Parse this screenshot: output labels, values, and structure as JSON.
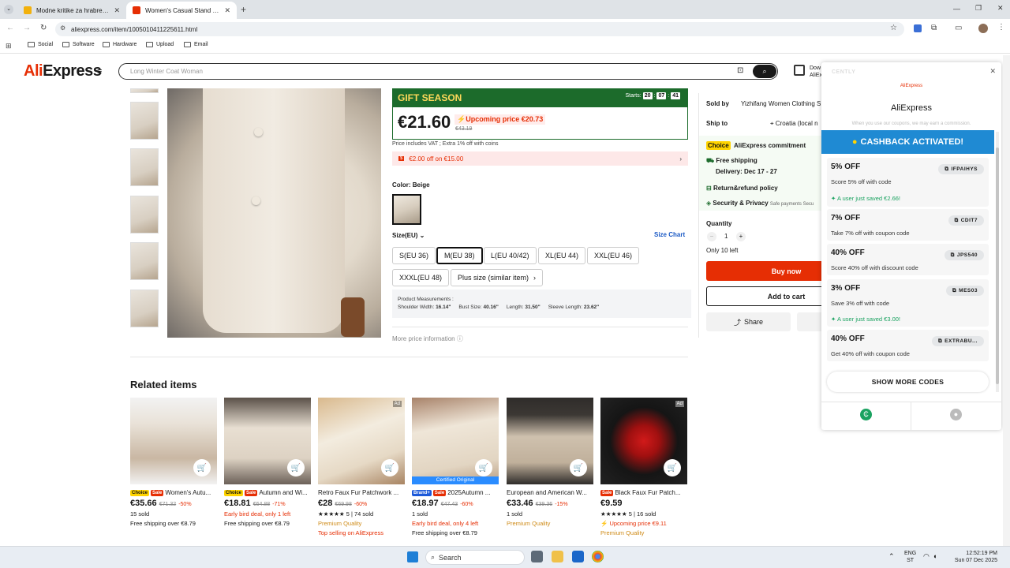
{
  "browser": {
    "tabs": [
      {
        "title": "Modne kritike za hrabre kokoši"
      },
      {
        "title": "Women's Casual Stand Collar L..."
      }
    ],
    "url": "aliexpress.com/item/1005010411225611.html",
    "bookmarks": [
      "Social",
      "Software",
      "Hardware",
      "Upload",
      "Email"
    ]
  },
  "header": {
    "logo_ali": "Ali",
    "logo_express": "Express",
    "search_placeholder": "Long Winter Coat Woman",
    "download_label": "Dow AliEx"
  },
  "gift": {
    "label": "GIFT SEASON",
    "starts_label": "Starts:",
    "h": "20",
    "m": "07",
    "s": "41"
  },
  "price": {
    "current": "€21.60",
    "upcoming": "Upcoming price €20.73",
    "original": "€43.19",
    "vat_note": "Price includes VAT ; Extra 1% off with coins",
    "coupon": "€2.00 off on €15.00"
  },
  "color": {
    "label": "Color: Beige"
  },
  "size": {
    "label": "Size(EU)",
    "chart": "Size Chart",
    "options": [
      "S(EU 36)",
      "M(EU 38)",
      "L(EU 40/42)",
      "XL(EU 44)",
      "XXL(EU 46)",
      "XXXL(EU 48)",
      "Plus size (similar item)"
    ],
    "selected": "M(EU 38)"
  },
  "measurements": {
    "title": "Product Measurements :",
    "shoulder_label": "Shoulder Width:",
    "shoulder": "16.14\"",
    "bust_label": "Bust Size:",
    "bust": "40.16\"",
    "length_label": "Length:",
    "length": "31.50\"",
    "sleeve_label": "Sleeve Length:",
    "sleeve": "23.62\""
  },
  "more_info": "More price information",
  "seller": {
    "sold_by_label": "Sold by",
    "sold_by": "Yizhifang Women Clothing S",
    "ship_to_label": "Ship to",
    "ship_to": "Croatia (local n",
    "choice": "Choice",
    "commitment": "AliExpress commitment",
    "free_shipping": "Free shipping",
    "delivery": "Delivery: Dec 17 - 27",
    "return": "Return&refund policy",
    "security": "Security & Privacy",
    "security_note": "Safe payments Secu",
    "quantity_label": "Quantity",
    "quantity": "1",
    "stock": "Only 10 left",
    "buy": "Buy now",
    "add": "Add to cart",
    "share": "Share"
  },
  "related": {
    "title": "Related items",
    "items": [
      {
        "tag1": "Choice",
        "tag2": "Sale",
        "title": "Women's Autu...",
        "price": "€35.66",
        "old": "€71.32",
        "pct": "-50%",
        "l1": "15 sold",
        "l2": "Free shipping over €8.79",
        "l3": ""
      },
      {
        "tag1": "Choice",
        "tag2": "Sale",
        "title": "Autumn and Wi...",
        "price": "€18.81",
        "old": "€64.88",
        "pct": "-71%",
        "l1": "Early bird deal, only 1 left",
        "l2": "Free shipping over €8.79",
        "l3": ""
      },
      {
        "tag1": "",
        "tag2": "",
        "title": "Retro Faux Fur Patchwork ...",
        "price": "€28",
        "old": "€69.98",
        "pct": "-60%",
        "l1": "★★★★★ 5 | 74 sold",
        "l2": "Premium Quality",
        "l3": "Top selling on AliExpress"
      },
      {
        "tag1": "Brand+",
        "tag2": "Sale",
        "title": "2025Autumn ...",
        "price": "€18.97",
        "old": "€47.43",
        "pct": "-60%",
        "l1": "1 sold",
        "l2": "Early bird deal, only 4 left",
        "l3": "Free shipping over €8.79",
        "cert": "Certified Original"
      },
      {
        "tag1": "",
        "tag2": "",
        "title": "European and American W...",
        "price": "€33.46",
        "old": "€39.36",
        "pct": "-15%",
        "l1": "1 sold",
        "l2": "Premium Quality",
        "l3": ""
      },
      {
        "tag1": "",
        "tag2": "Sale",
        "title": "Black Faux Fur Patch...",
        "price": "€9.59",
        "old": "",
        "pct": "",
        "l1": "★★★★★ 5 | 16 sold",
        "l2": "Upcoming price €9.11",
        "l3": "Premium Quality"
      }
    ]
  },
  "cently": {
    "brand": "CENTLY",
    "store_logo": "AliExpress",
    "store": "AliExpress",
    "note": "When you use our coupons, we may earn a commission.",
    "banner": "CASHBACK ACTIVATED!",
    "show_more": "SHOW MORE CODES",
    "codes": [
      {
        "title": "5% OFF",
        "code": "IFPAIHYS",
        "desc": "Score 5% off with code",
        "saved": "A user just saved €2.66!"
      },
      {
        "title": "7% OFF",
        "code": "CDIT7",
        "desc": "Take 7% off with coupon code",
        "saved": ""
      },
      {
        "title": "40% OFF",
        "code": "JPS540",
        "desc": "Score 40% off with discount code",
        "saved": ""
      },
      {
        "title": "3% OFF",
        "code": "MES03",
        "desc": "Save 3% off with code",
        "saved": "A user just saved €3.00!"
      },
      {
        "title": "40% OFF",
        "code": "EXTRABU...",
        "desc": "Get 40% off with coupon code",
        "saved": ""
      }
    ]
  },
  "taskbar": {
    "search": "Search",
    "lang1": "ENG",
    "lang2": "ST",
    "time": "12:52:19 PM",
    "date": "Sun 07 Dec 2025"
  }
}
